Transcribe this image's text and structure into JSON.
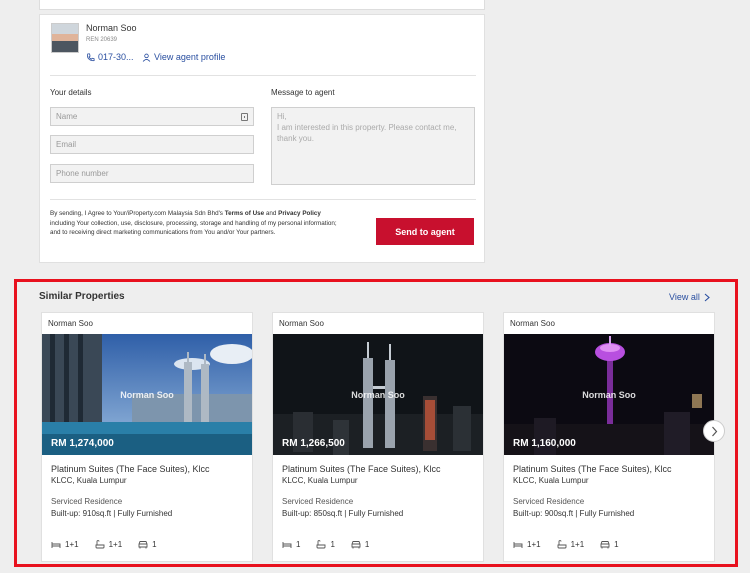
{
  "agent": {
    "name": "Norman Soo",
    "ren": "REN 20639",
    "phone": "017-30...",
    "view_profile": "View agent profile"
  },
  "form": {
    "your_details_label": "Your details",
    "message_label": "Message to agent",
    "name_placeholder": "Name",
    "email_placeholder": "Email",
    "phone_placeholder": "Phone number",
    "message_placeholder": "Hi,\nI am interested in this property. Please contact me, thank you.",
    "consent_pre": "By sending, I Agree to Your/iProperty.com Malaysia Sdn Bhd's ",
    "terms": "Terms of Use",
    "consent_and": " and ",
    "privacy": "Privacy Policy",
    "consent_post": " including Your collection, use, disclosure, processing, storage and handling of my personal information; and to receiving direct marketing communications from You and/or Your partners.",
    "send_label": "Send to agent"
  },
  "similar": {
    "title": "Similar Properties",
    "view_all": "View all",
    "watermark": "Norman Soo",
    "cards": [
      {
        "agent": "Norman Soo",
        "price": "RM 1,274,000",
        "title": "Platinum Suites (The Face Suites), Klcc",
        "location": "KLCC, Kuala Lumpur",
        "type": "Serviced Residence",
        "spec": "Built-up: 910sq.ft  | Fully Furnished",
        "beds": "1+1",
        "baths": "1+1",
        "parking": "1"
      },
      {
        "agent": "Norman Soo",
        "price": "RM 1,266,500",
        "title": "Platinum Suites (The Face Suites), Klcc",
        "location": "KLCC, Kuala Lumpur",
        "type": "Serviced Residence",
        "spec": "Built-up: 850sq.ft  | Fully Furnished",
        "beds": "1",
        "baths": "1",
        "parking": "1"
      },
      {
        "agent": "Norman Soo",
        "price": "RM 1,160,000",
        "title": "Platinum Suites (The Face Suites), Klcc",
        "location": "KLCC, Kuala Lumpur",
        "type": "Serviced Residence",
        "spec": "Built-up: 900sq.ft  | Fully Furnished",
        "beds": "1+1",
        "baths": "1+1",
        "parking": "1"
      }
    ]
  },
  "colors": {
    "accent": "#c8102e",
    "link": "#2a4fa0",
    "highlight": "#e8111e"
  }
}
